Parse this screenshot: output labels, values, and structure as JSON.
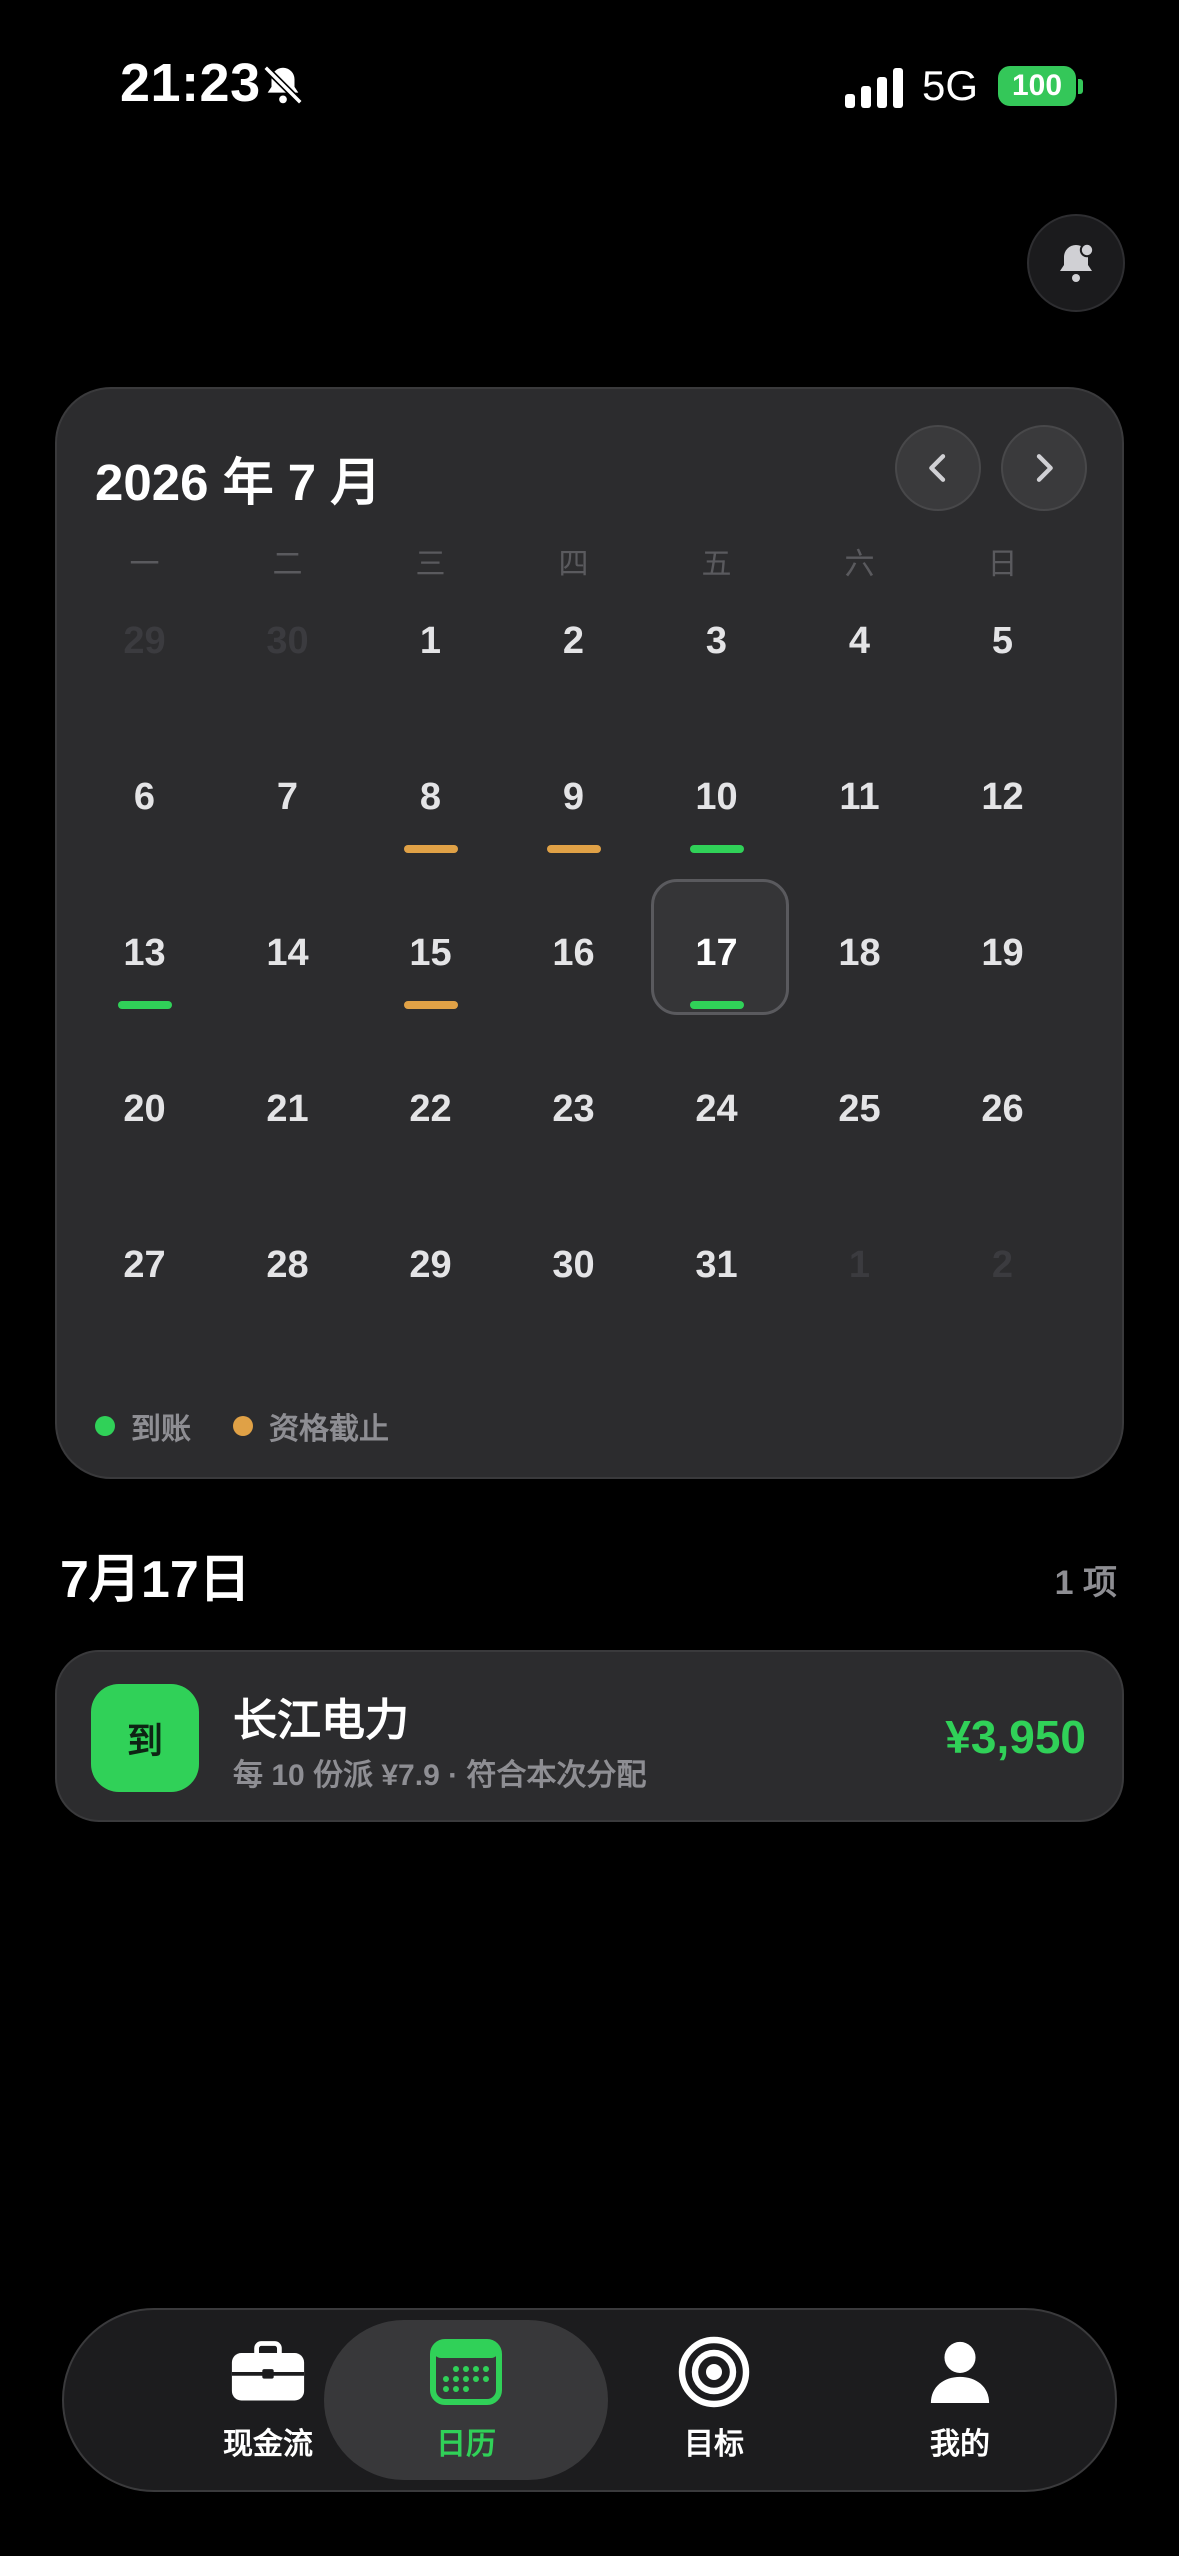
{
  "status_bar": {
    "time": "21:23",
    "network": "5G",
    "battery": "100",
    "icons": [
      "bell-slash-icon",
      "signal-icon",
      "battery-icon"
    ]
  },
  "header": {
    "notification_icon": "bell-badge-icon"
  },
  "calendar": {
    "title": "2026 年 7 月",
    "prev_icon": "chevron-left-icon",
    "next_icon": "chevron-right-icon",
    "weekdays": [
      "一",
      "二",
      "三",
      "四",
      "五",
      "六",
      "日"
    ],
    "days": [
      {
        "label": "29",
        "muted": true,
        "mark": ""
      },
      {
        "label": "30",
        "muted": true,
        "mark": ""
      },
      {
        "label": "1",
        "muted": false,
        "mark": ""
      },
      {
        "label": "2",
        "muted": false,
        "mark": ""
      },
      {
        "label": "3",
        "muted": false,
        "mark": ""
      },
      {
        "label": "4",
        "muted": false,
        "mark": ""
      },
      {
        "label": "5",
        "muted": false,
        "mark": ""
      },
      {
        "label": "6",
        "muted": false,
        "mark": ""
      },
      {
        "label": "7",
        "muted": false,
        "mark": ""
      },
      {
        "label": "8",
        "muted": false,
        "mark": "orange"
      },
      {
        "label": "9",
        "muted": false,
        "mark": "orange"
      },
      {
        "label": "10",
        "muted": false,
        "mark": "green"
      },
      {
        "label": "11",
        "muted": false,
        "mark": ""
      },
      {
        "label": "12",
        "muted": false,
        "mark": ""
      },
      {
        "label": "13",
        "muted": false,
        "mark": "green"
      },
      {
        "label": "14",
        "muted": false,
        "mark": ""
      },
      {
        "label": "15",
        "muted": false,
        "mark": "orange"
      },
      {
        "label": "16",
        "muted": false,
        "mark": ""
      },
      {
        "label": "17",
        "muted": false,
        "mark": "green",
        "selected": true
      },
      {
        "label": "18",
        "muted": false,
        "mark": ""
      },
      {
        "label": "19",
        "muted": false,
        "mark": ""
      },
      {
        "label": "20",
        "muted": false,
        "mark": ""
      },
      {
        "label": "21",
        "muted": false,
        "mark": ""
      },
      {
        "label": "22",
        "muted": false,
        "mark": ""
      },
      {
        "label": "23",
        "muted": false,
        "mark": ""
      },
      {
        "label": "24",
        "muted": false,
        "mark": ""
      },
      {
        "label": "25",
        "muted": false,
        "mark": ""
      },
      {
        "label": "26",
        "muted": false,
        "mark": ""
      },
      {
        "label": "27",
        "muted": false,
        "mark": ""
      },
      {
        "label": "28",
        "muted": false,
        "mark": ""
      },
      {
        "label": "29",
        "muted": false,
        "mark": ""
      },
      {
        "label": "30",
        "muted": false,
        "mark": ""
      },
      {
        "label": "31",
        "muted": false,
        "mark": ""
      },
      {
        "label": "1",
        "muted": true,
        "mark": ""
      },
      {
        "label": "2",
        "muted": true,
        "mark": ""
      }
    ],
    "legend": [
      {
        "label": "到账",
        "color": "#30d158"
      },
      {
        "label": "资格截止",
        "color": "#e0a146"
      }
    ]
  },
  "selected_day": {
    "date_label": "7月17日",
    "count_label": "1 项"
  },
  "events": [
    {
      "badge": "到",
      "title": "长江电力",
      "subtitle": "每 10 份派 ¥7.9 · 符合本次分配",
      "amount": "¥3,950",
      "color": "#30d158"
    }
  ],
  "tab_bar": {
    "tabs": [
      {
        "label": "现金流",
        "icon": "briefcase-icon",
        "active": false
      },
      {
        "label": "日历",
        "icon": "calendar-icon",
        "active": true
      },
      {
        "label": "目标",
        "icon": "target-icon",
        "active": false
      },
      {
        "label": "我的",
        "icon": "person-icon",
        "active": false
      }
    ]
  },
  "colors": {
    "accent_green": "#30d158",
    "accent_orange": "#e0a146",
    "card_bg": "#2c2c2e"
  }
}
